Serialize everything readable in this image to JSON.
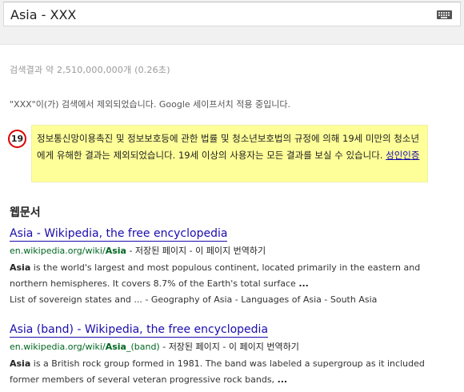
{
  "search": {
    "query": "Asia - XXX",
    "keyboard_icon": "keyboard-icon"
  },
  "stats": "검색결과 약 2,510,000,000개 (0.26초)",
  "safesearch_note": "\"XXX\"이(가) 검색에서 제외되었습니다. Google 세이프서치 적용 중입니다.",
  "warning": {
    "badge": "19",
    "text": "정보통신망이용촉진 및 정보보호등에 관한 법률 및 청소년보호법의 규정에 의해 19세 미만의 청소년에게 유해한 결과는 제외되었습니다. 19세 이상의 사용자는 모든 결과를 보실 수 있습니다.",
    "link": "성인인증",
    "accent": "#ffff99"
  },
  "section_title": "웹문서",
  "results": [
    {
      "title_bold": "Asia",
      "title_rest": " - Wikipedia, the free encyclopedia",
      "url_prefix": "en.wikipedia.org/wiki/",
      "url_bold": "Asia",
      "cached": "저장된 페이지",
      "translate": "이 페이지 번역하기",
      "snippet_bold": "Asia",
      "snippet_rest": " is the world's largest and most populous continent, located primarily in the eastern and northern hemispheres. It covers 8.7% of the Earth's total surface",
      "snippet_ellipsis": "...",
      "links": [
        "List of sovereign states and ...",
        "Geography of Asia",
        "Languages of Asia",
        "South Asia"
      ]
    },
    {
      "title_bold": "Asia",
      "title_rest": " (band) - Wikipedia, the free encyclopedia",
      "url_prefix": "en.wikipedia.org/wiki/",
      "url_bold": "Asia",
      "url_suffix": "_(band)",
      "cached": "저장된 페이지",
      "translate": "이 페이지 번역하기",
      "snippet_bold": "Asia",
      "snippet_rest": " is a British rock group formed in 1981. The band was labeled a supergroup as it included former members of several veteran progressive rock bands,",
      "snippet_ellipsis": "..."
    }
  ]
}
